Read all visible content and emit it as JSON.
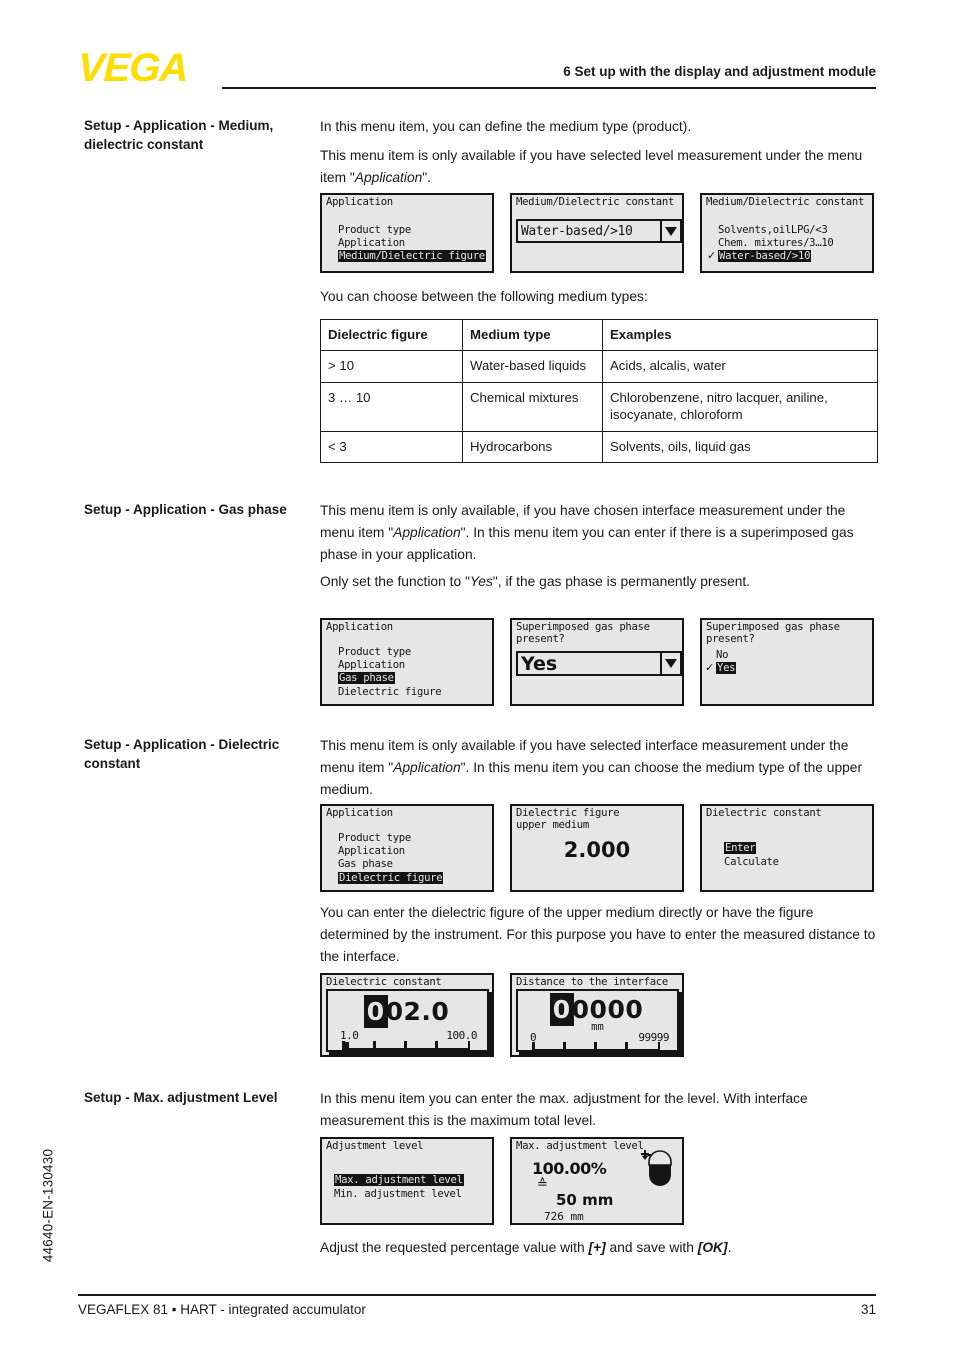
{
  "header": {
    "logo": "VEGA",
    "chapter_title": "6 Set up with the display and adjustment module"
  },
  "sidecode": "44640-EN-130430",
  "footer": {
    "left": "VEGAFLEX 81 • HART - integrated accumulator",
    "page": "31"
  },
  "sections": [
    {
      "heading": "Setup - Application - Medium, dielectric constant",
      "paragraphs": [
        "In this menu item, you can define the medium type (product).",
        "This menu item is only available if you have selected level measurement under the menu item \"Application\".",
        "You can choose between the following medium types:"
      ]
    },
    {
      "heading": "Setup - Application - Gas phase",
      "paragraphs": [
        "This menu item is only available, if you have chosen interface measurement under the menu item \"Application\". In this menu item you can enter if there is a superimposed gas phase in your application.",
        "Only set the function to \"Yes\", if the gas phase is permanently present."
      ]
    },
    {
      "heading": "Setup - Application - Dielectric constant",
      "paragraphs": [
        "This menu item is only available if you have selected interface measurement under the menu item \"Application\". In this menu item you can choose the medium type of the upper medium.",
        "You can enter the dielectric figure of the upper medium directly or have the figure determined by the instrument. For this purpose you have to enter the measured distance to the interface."
      ]
    },
    {
      "heading": "Setup - Max. adjustment Level",
      "paragraphs": [
        "In this menu item you can enter the max. adjustment for the level. With interface measurement this is the maximum total level.",
        "Adjust the requested percentage value with [+] and save with [OK]."
      ]
    }
  ],
  "medium_table": {
    "headers": [
      "Dielectric figure",
      "Medium type",
      "Examples"
    ],
    "rows": [
      [
        "> 10",
        "Water-based liquids",
        "Acids, alcalis, water"
      ],
      [
        "3 … 10",
        "Chemical mixtures",
        "Chlorobenzene, nitro lacquer, aniline, isocyanate, chloroform"
      ],
      [
        "< 3",
        "Hydrocarbons",
        "Solvents, oils, liquid gas"
      ]
    ]
  },
  "screens": {
    "row1": {
      "s1": {
        "title": "Application",
        "items": [
          "Product type",
          "Application",
          "Medium/Dielectric figure"
        ],
        "selected": "Medium/Dielectric figure"
      },
      "s2": {
        "title": "Medium/Dielectric constant",
        "value": "Water-based/>10",
        "arrow": "chevron-down-icon"
      },
      "s3": {
        "title": "Medium/Dielectric constant",
        "items": [
          "Solvents,oilLPG/<3",
          "Chem. mixtures/3…10",
          "Water-based/>10"
        ],
        "selected": "Water-based/>10",
        "check": "✓"
      }
    },
    "row2": {
      "s1": {
        "title": "Application",
        "items": [
          "Product type",
          "Application",
          "Gas phase",
          "Dielectric figure"
        ],
        "selected": "Gas phase"
      },
      "s2": {
        "title": "Superimposed gas phase",
        "title2": "present?",
        "value": "Yes",
        "arrow": "chevron-down-icon"
      },
      "s3": {
        "title": "Superimposed gas phase",
        "title2": "present?",
        "items": [
          "No",
          "Yes"
        ],
        "selected": "Yes",
        "check": "✓"
      }
    },
    "row3": {
      "s1": {
        "title": "Application",
        "items": [
          "Product type",
          "Application",
          "Gas phase",
          "Dielectric figure"
        ],
        "selected": "Dielectric figure"
      },
      "s2": {
        "title": "Dielectric figure",
        "title2": "upper medium",
        "value": "2.000"
      },
      "s3": {
        "title": "Dielectric constant",
        "items": [
          "Enter",
          "Calculate"
        ],
        "selected": "Enter"
      }
    },
    "row4": {
      "s1": {
        "title": "Dielectric constant",
        "cursor": "0",
        "rest": "02.0",
        "scale_low": "1.0",
        "scale_high": "100.0"
      },
      "s2": {
        "title": "Distance to the interface",
        "cursor": "0",
        "rest": "0000",
        "unit": "mm",
        "scale_low": "0",
        "scale_high": "99999"
      }
    },
    "row5": {
      "s1": {
        "title": "Adjustment level",
        "items": [
          "Max. adjustment level",
          "Min. adjustment level"
        ],
        "selected": "Max. adjustment level"
      },
      "s2": {
        "title": "Max. adjustment level",
        "percent": "100.00%",
        "equiv_symbol": "≙",
        "value": "50 mm",
        "distance": "726 mm",
        "icon": "tank-level-icon"
      }
    }
  }
}
